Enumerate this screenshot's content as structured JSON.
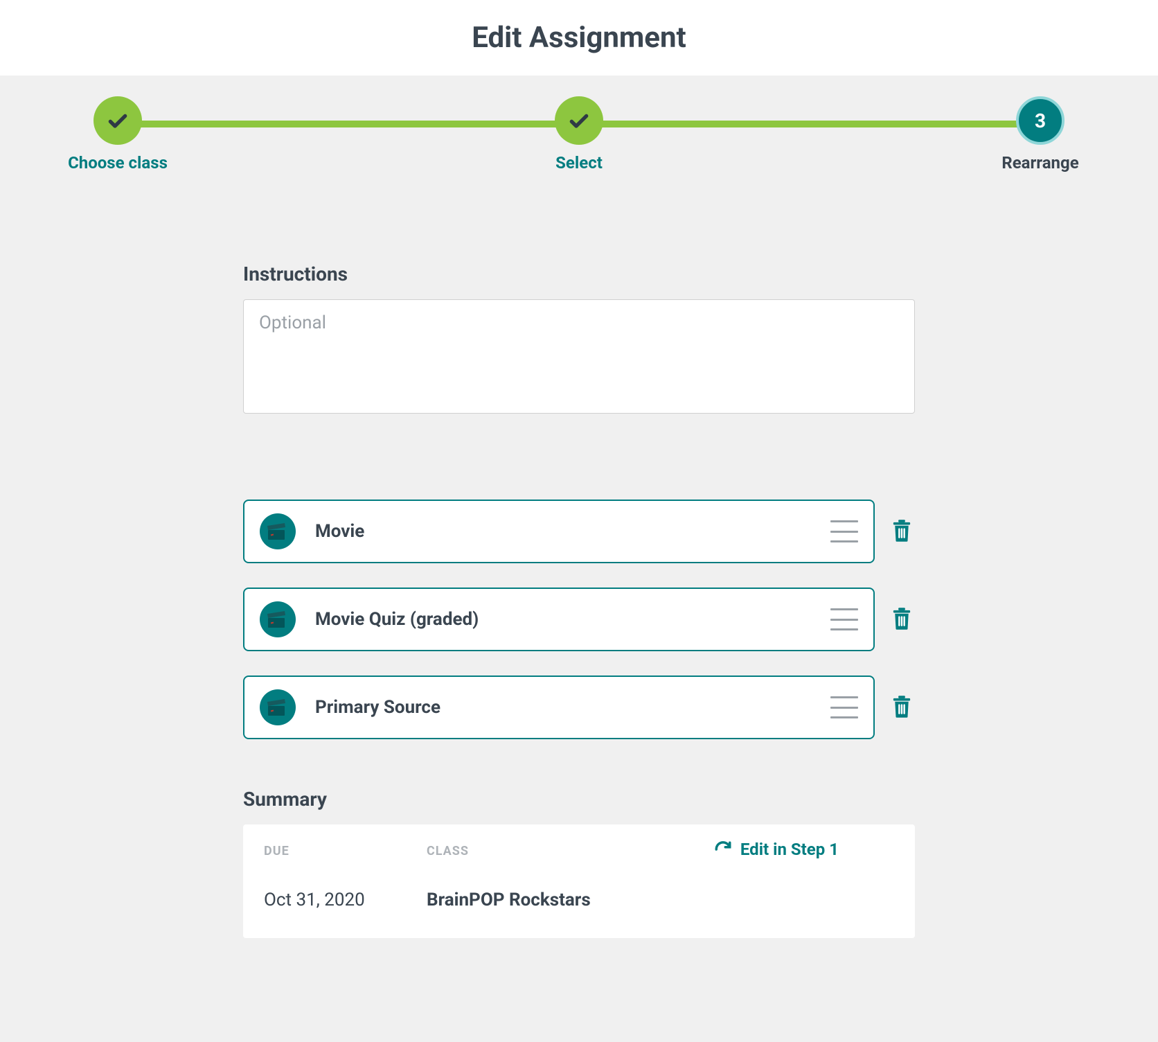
{
  "header": {
    "title": "Edit Assignment"
  },
  "stepper": {
    "steps": [
      {
        "label": "Choose class",
        "state": "completed"
      },
      {
        "label": "Select",
        "state": "completed"
      },
      {
        "label": "Rearrange",
        "state": "active",
        "number": "3"
      }
    ]
  },
  "instructions": {
    "label": "Instructions",
    "placeholder": "Optional",
    "value": ""
  },
  "activities": [
    {
      "title": "Movie"
    },
    {
      "title": "Movie Quiz (graded)"
    },
    {
      "title": "Primary Source"
    }
  ],
  "summary": {
    "label": "Summary",
    "due_header": "DUE",
    "class_header": "CLASS",
    "due_value": "Oct 31, 2020",
    "class_value": "BrainPOP Rockstars",
    "edit_link": "Edit in Step 1"
  }
}
